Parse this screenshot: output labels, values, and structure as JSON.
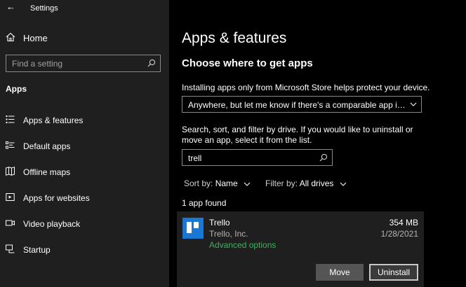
{
  "window": {
    "title": "Settings"
  },
  "sidebar": {
    "home_label": "Home",
    "search_placeholder": "Find a setting",
    "section_label": "Apps",
    "items": [
      {
        "label": "Apps & features",
        "icon": "list-icon"
      },
      {
        "label": "Default apps",
        "icon": "default-apps-icon"
      },
      {
        "label": "Offline maps",
        "icon": "map-icon"
      },
      {
        "label": "Apps for websites",
        "icon": "link-box-icon"
      },
      {
        "label": "Video playback",
        "icon": "video-icon"
      },
      {
        "label": "Startup",
        "icon": "startup-icon"
      }
    ]
  },
  "main": {
    "title": "Apps & features",
    "subheading": "Choose where to get apps",
    "source_description": "Installing apps only from Microsoft Store helps protect your device.",
    "source_dropdown_value": "Anywhere, but let me know if there's a comparable app in t...",
    "filter_description": "Search, sort, and filter by drive. If you would like to uninstall or move an app, select it from the list.",
    "filter_value": "trell",
    "sort": {
      "label": "Sort by:",
      "value": "Name"
    },
    "filter_drive": {
      "label": "Filter by:",
      "value": "All drives"
    },
    "results_count": "1 app found",
    "app": {
      "name": "Trello",
      "publisher": "Trello, Inc.",
      "advanced_link": "Advanced options",
      "size": "354 MB",
      "date": "1/28/2021",
      "move_label": "Move",
      "uninstall_label": "Uninstall"
    }
  },
  "colors": {
    "sidebar_bg": "#1f1f1f",
    "main_bg": "#000000",
    "link_green": "#3cb35a",
    "trello_blue": "#1a78d5"
  }
}
